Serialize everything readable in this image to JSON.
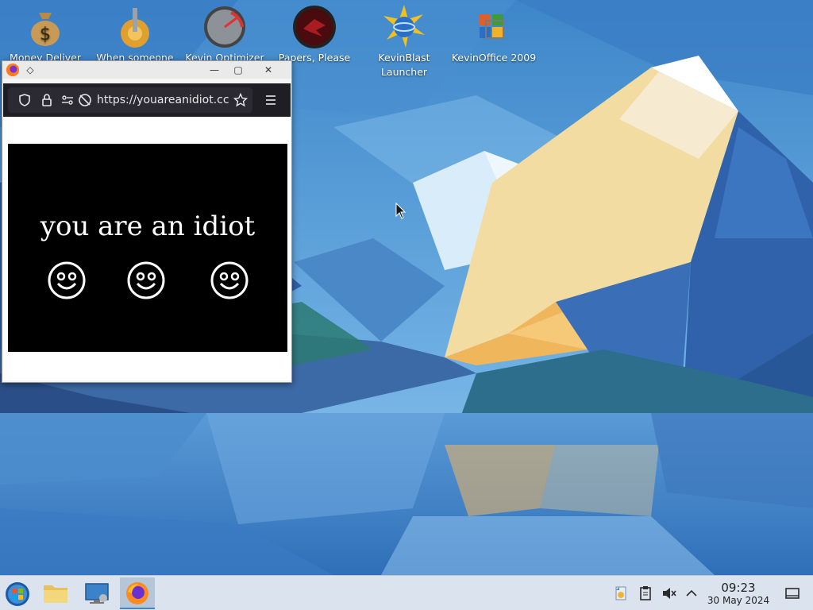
{
  "desktop": {
    "icons": [
      {
        "label": "Money Deliver",
        "icon": "money-bag-icon"
      },
      {
        "label": "When someone says a",
        "icon": "gear-lever-icon"
      },
      {
        "label": "Kevin Optimizer Pro",
        "icon": "speedometer-icon"
      },
      {
        "label": "Papers, Please",
        "icon": "papers-please-icon"
      },
      {
        "label": "KevinBlast Launcher",
        "icon": "kevinblast-globe-icon"
      },
      {
        "label": "KevinOffice 2009",
        "icon": "office-logo-icon"
      }
    ]
  },
  "browser": {
    "url": "https://youareanidiot.cc",
    "page_text": "you are an idiot",
    "smileys": [
      "☺",
      "☺",
      "☺"
    ],
    "titlebar_buttons": {
      "minimize": "—",
      "maximize": "▢",
      "close": "✕"
    }
  },
  "taskbar": {
    "start_icon": "start-orb-icon",
    "pinned": [
      "file-manager-icon",
      "system-settings-icon",
      "firefox-icon"
    ],
    "tray": [
      "updates-icon",
      "clipboard-icon",
      "volume-muted-icon",
      "tray-expand-icon"
    ],
    "time": "09:23",
    "date": "30 May 2024",
    "show_desktop_icon": "show-desktop-icon"
  },
  "colors": {
    "sky": "#5b9bd3",
    "taskbar": "#dbe4ee",
    "browser_toolbar": "#1f1e25"
  }
}
